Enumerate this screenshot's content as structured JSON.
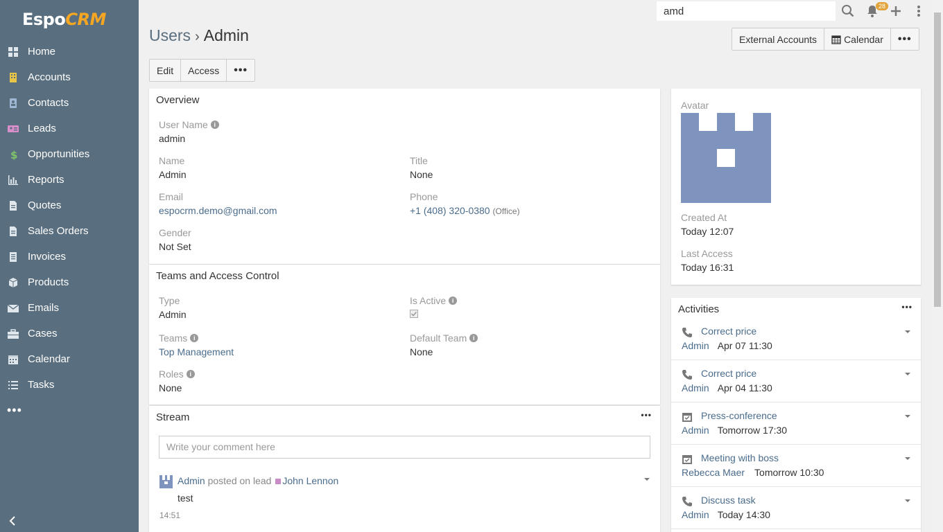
{
  "app": {
    "logo_main": "Espo",
    "logo_accent": "CRM"
  },
  "nav": [
    {
      "label": "Home",
      "icon": "home-icon"
    },
    {
      "label": "Accounts",
      "icon": "building-icon"
    },
    {
      "label": "Contacts",
      "icon": "contact-icon"
    },
    {
      "label": "Leads",
      "icon": "id-card-icon"
    },
    {
      "label": "Opportunities",
      "icon": "dollar-icon"
    },
    {
      "label": "Reports",
      "icon": "bar-chart-icon"
    },
    {
      "label": "Quotes",
      "icon": "document-icon"
    },
    {
      "label": "Sales Orders",
      "icon": "document-icon"
    },
    {
      "label": "Invoices",
      "icon": "receipt-icon"
    },
    {
      "label": "Products",
      "icon": "cube-icon"
    },
    {
      "label": "Emails",
      "icon": "envelope-icon"
    },
    {
      "label": "Cases",
      "icon": "briefcase-icon"
    },
    {
      "label": "Calendar",
      "icon": "calendar-icon"
    },
    {
      "label": "Tasks",
      "icon": "list-icon"
    }
  ],
  "nav_more": "•••",
  "header": {
    "search_value": "amd",
    "notification_count": "28"
  },
  "title": {
    "crumb": "Users",
    "separator": "›",
    "current": "Admin"
  },
  "actions": {
    "edit": "Edit",
    "access": "Access",
    "more": "•••"
  },
  "top_actions": {
    "external_accounts": "External Accounts",
    "calendar": "Calendar",
    "more": "•••"
  },
  "overview": {
    "heading": "Overview",
    "user_name_label": "User Name",
    "user_name": "admin",
    "name_label": "Name",
    "name": "Admin",
    "title_label": "Title",
    "title": "None",
    "email_label": "Email",
    "email": "espocrm.demo@gmail.com",
    "phone_label": "Phone",
    "phone": "+1 (408) 320-0380",
    "phone_type": "(Office)",
    "gender_label": "Gender",
    "gender": "Not Set"
  },
  "teams": {
    "heading": "Teams and Access Control",
    "type_label": "Type",
    "type": "Admin",
    "is_active_label": "Is Active",
    "teams_label": "Teams",
    "teams": "Top Management",
    "default_team_label": "Default Team",
    "default_team": "None",
    "roles_label": "Roles",
    "roles": "None"
  },
  "stream": {
    "heading": "Stream",
    "more": "•••",
    "placeholder": "Write your comment here",
    "post_author": "Admin",
    "post_action": "posted on lead",
    "post_target": "John Lennon",
    "post_text": "test",
    "post_time": "14:51"
  },
  "side": {
    "avatar_label": "Avatar",
    "created_label": "Created At",
    "created": "Today 12:07",
    "last_access_label": "Last Access",
    "last_access": "Today 16:31"
  },
  "activities": {
    "heading": "Activities",
    "more": "•••",
    "items": [
      {
        "title": "Correct price",
        "user": "Admin",
        "time": "Apr 07 11:30",
        "icon": "phone-icon"
      },
      {
        "title": "Correct price",
        "user": "Admin",
        "time": "Apr 04 11:30",
        "icon": "phone-icon"
      },
      {
        "title": "Press-conference",
        "user": "Admin",
        "time": "Tomorrow 17:30",
        "icon": "calendar-check-icon"
      },
      {
        "title": "Meeting with boss",
        "user": "Rebecca Maer",
        "time": "Tomorrow 10:30",
        "icon": "calendar-check-icon"
      },
      {
        "title": "Discuss task",
        "user": "Admin",
        "time": "Today 14:30",
        "icon": "phone-icon"
      }
    ]
  },
  "colors": {
    "sidebar": "#596e7e",
    "link": "#4a6c8c",
    "avatar": "#7f93bf",
    "lead_badge": "#c98cc7",
    "badge": "#e2a33a"
  }
}
